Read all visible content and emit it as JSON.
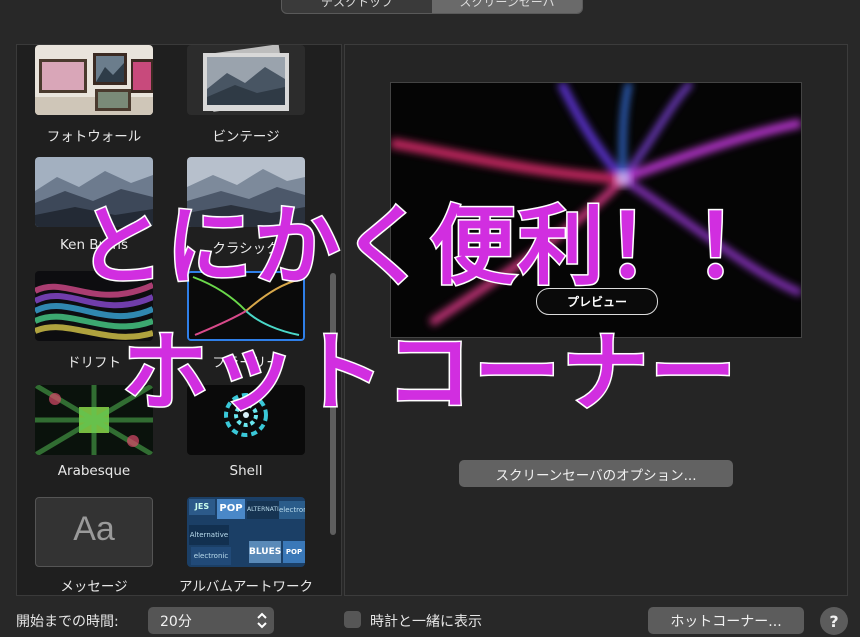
{
  "tabs": [
    {
      "label": "デスクトップ",
      "selected": false
    },
    {
      "label": "スクリーンセーバ",
      "selected": true
    }
  ],
  "screensavers": [
    {
      "label": "フォトウォール",
      "icon": "photo-wall-thumbnail"
    },
    {
      "label": "ビンテージ",
      "icon": "vintage-thumbnail"
    },
    {
      "label": "Ken Burns",
      "icon": "ken-burns-thumbnail"
    },
    {
      "label": "クラシック",
      "icon": "classic-thumbnail"
    },
    {
      "label": "ドリフト",
      "icon": "drift-thumbnail"
    },
    {
      "label": "フラーリー",
      "icon": "flurry-thumbnail"
    },
    {
      "label": "Arabesque",
      "icon": "arabesque-thumbnail"
    },
    {
      "label": "Shell",
      "icon": "shell-thumbnail"
    },
    {
      "label": "メッセージ",
      "icon": "message-thumbnail"
    },
    {
      "label": "アルバムアートワーク",
      "icon": "album-artwork-thumbnail"
    }
  ],
  "message_thumb_text": "Aa",
  "album_tiles": [
    "JES",
    "POP",
    "ALTERNATIVE",
    "electronic",
    "Alternative",
    "electronic",
    "BLUES",
    "POP"
  ],
  "preview": {
    "button_label": "プレビュー"
  },
  "options_button_label": "スクリーンセーバのオプション...",
  "start_time": {
    "label": "開始までの時間:",
    "value": "20分"
  },
  "show_clock": {
    "label": "時計と一緒に表示",
    "checked": false
  },
  "hot_corners_button_label": "ホットコーナー...",
  "help_button_label": "?",
  "overlay": {
    "line1": "とにかく便利！！",
    "line2": "ホットコーナー"
  },
  "colors": {
    "overlay_text": "#d12ee0",
    "overlay_outline": "#ffffff",
    "background": "#282828"
  }
}
